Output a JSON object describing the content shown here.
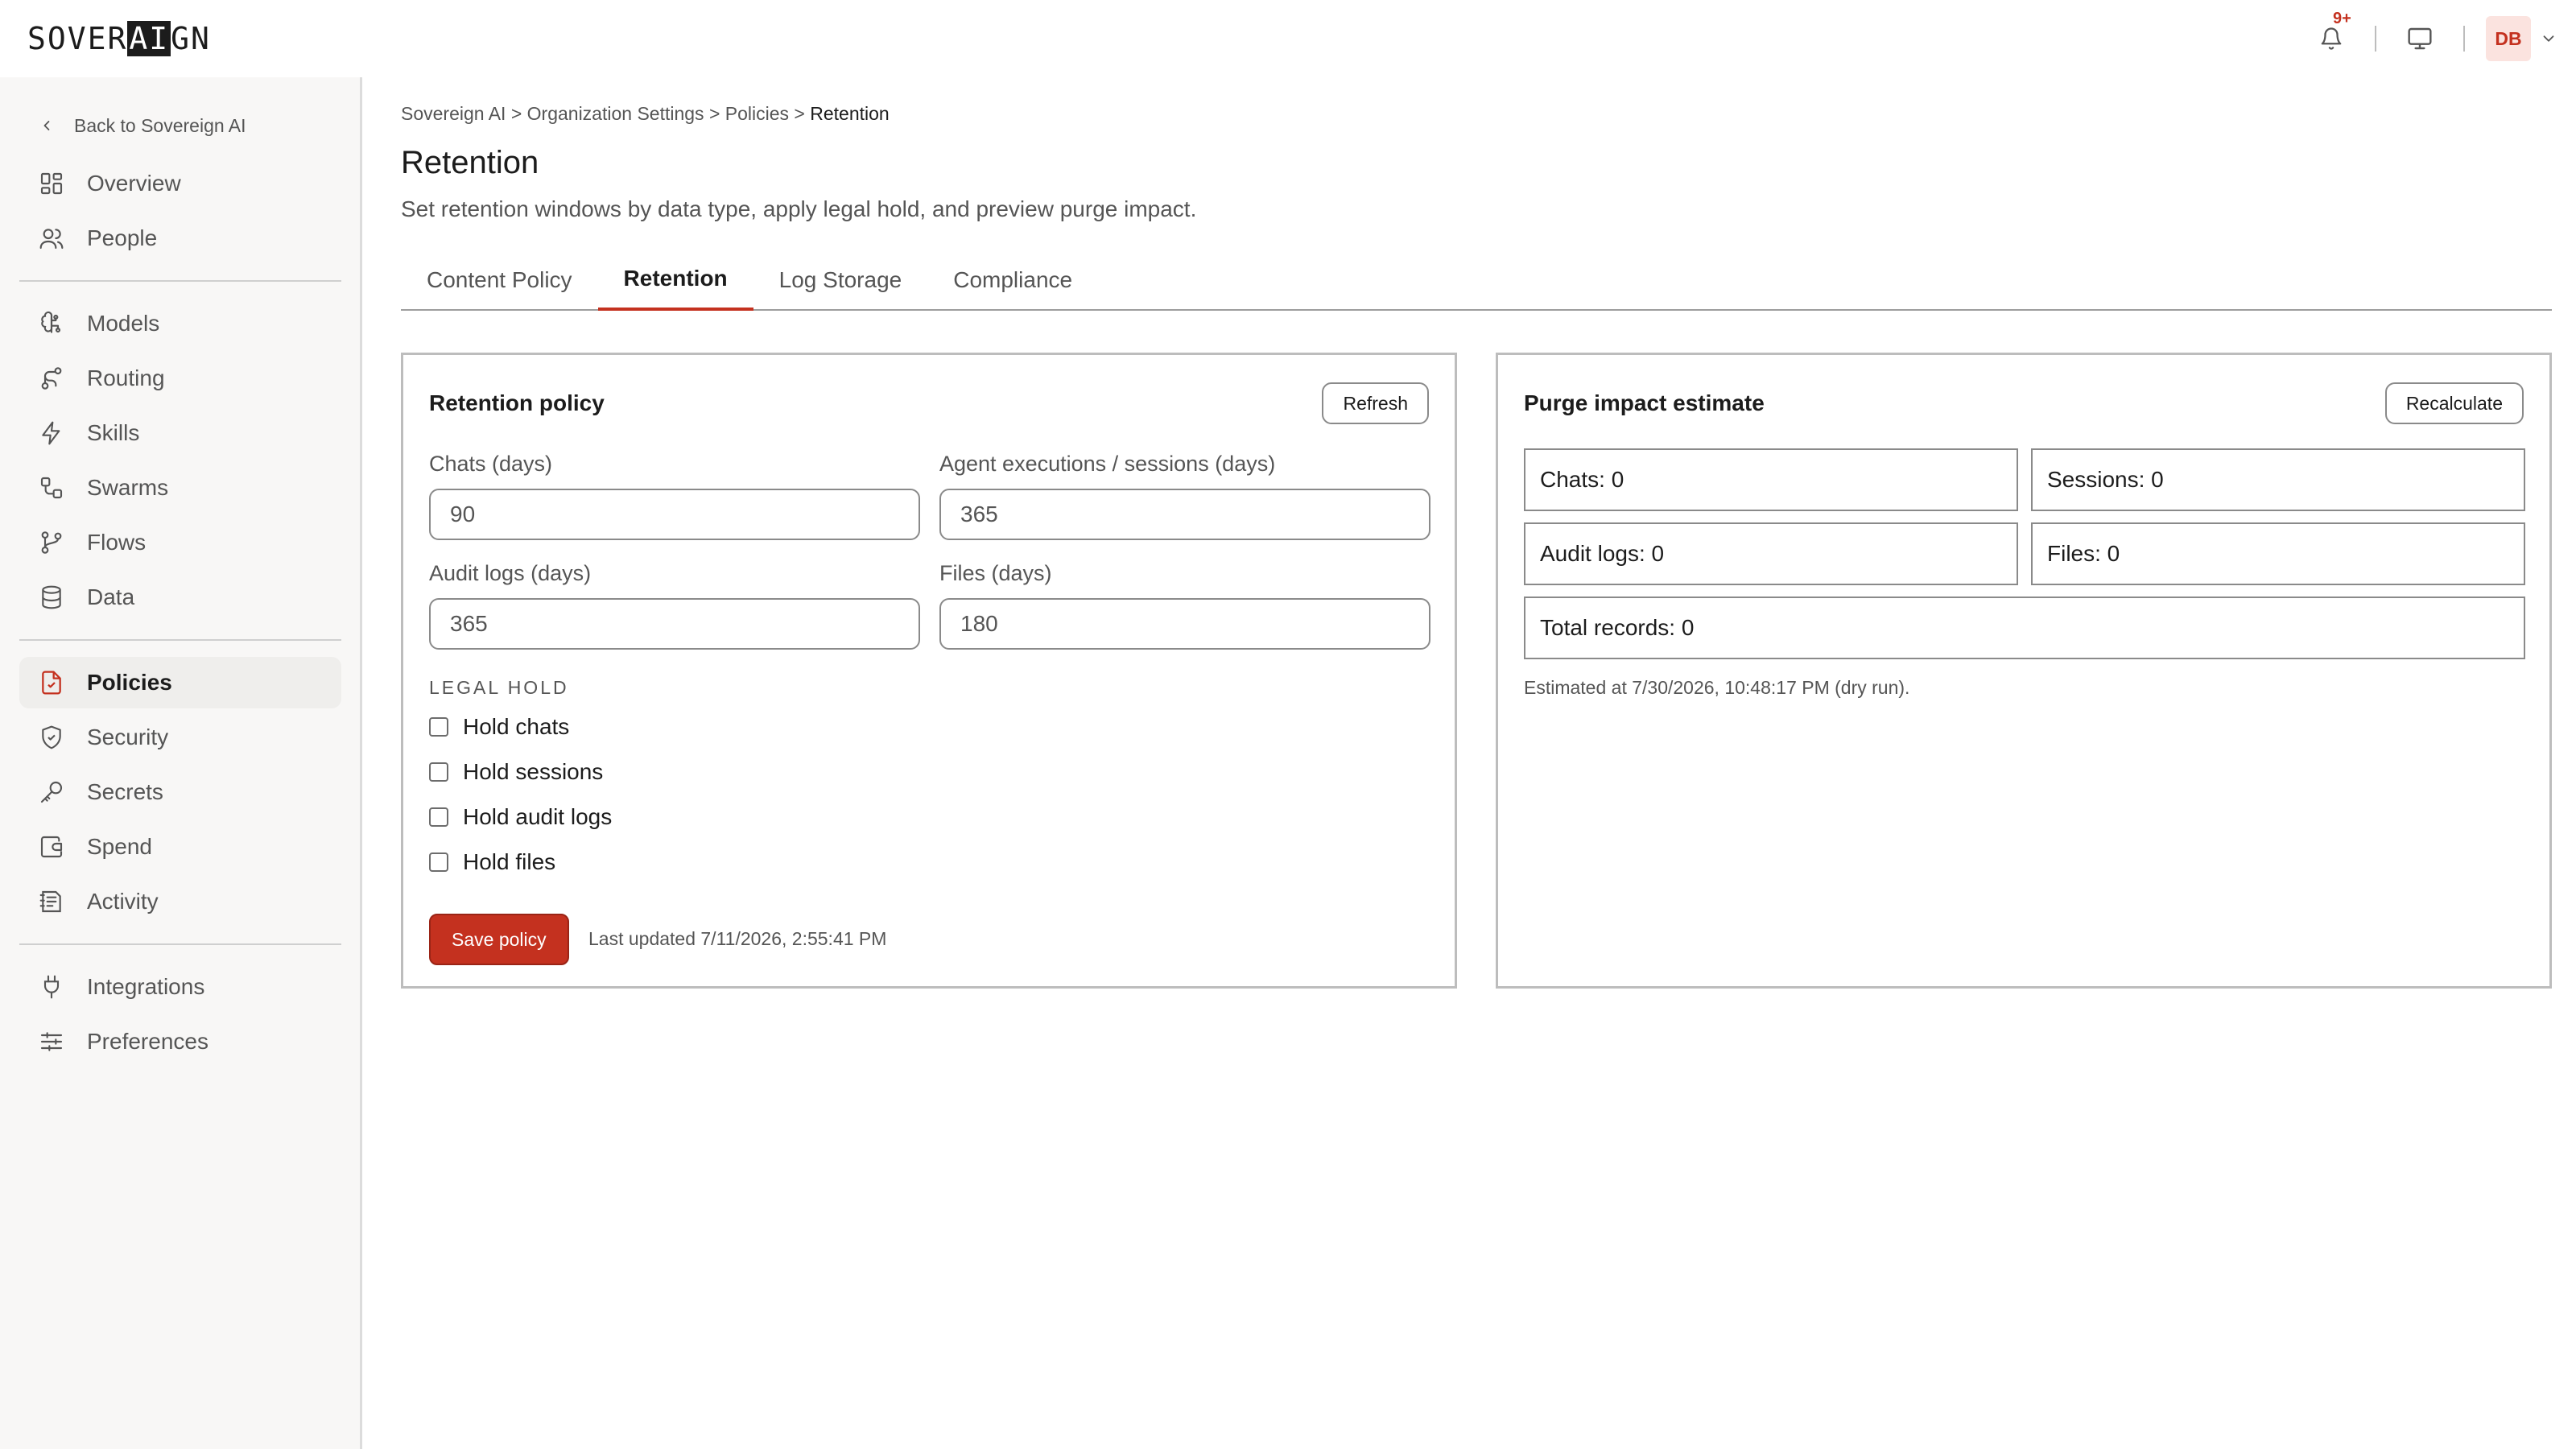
{
  "brand": {
    "logo_pre": "SOVER",
    "logo_hl": "AI",
    "logo_post": "GN"
  },
  "topbar": {
    "notification_badge": "9+",
    "avatar_initials": "DB"
  },
  "sidebar": {
    "back_label": "Back to Sovereign AI",
    "groups": [
      [
        {
          "label": "Overview",
          "icon": "overview-grid-icon"
        },
        {
          "label": "People",
          "icon": "people-icon"
        }
      ],
      [
        {
          "label": "Models",
          "icon": "brain-icon"
        },
        {
          "label": "Routing",
          "icon": "routing-icon"
        },
        {
          "label": "Skills",
          "icon": "bolt-icon"
        },
        {
          "label": "Swarms",
          "icon": "swarm-icon"
        },
        {
          "label": "Flows",
          "icon": "flow-branch-icon"
        },
        {
          "label": "Data",
          "icon": "database-icon"
        }
      ],
      [
        {
          "label": "Policies",
          "icon": "policy-document-icon",
          "active": true
        },
        {
          "label": "Security",
          "icon": "shield-icon"
        },
        {
          "label": "Secrets",
          "icon": "key-icon"
        },
        {
          "label": "Spend",
          "icon": "wallet-icon"
        },
        {
          "label": "Activity",
          "icon": "activity-log-icon"
        }
      ],
      [
        {
          "label": "Integrations",
          "icon": "plug-icon"
        },
        {
          "label": "Preferences",
          "icon": "sliders-icon"
        }
      ]
    ]
  },
  "breadcrumb": {
    "items": [
      "Sovereign AI",
      "Organization Settings",
      "Policies"
    ],
    "current": "Retention",
    "separator": ">"
  },
  "page": {
    "title": "Retention",
    "subtitle": "Set retention windows by data type, apply legal hold, and preview purge impact."
  },
  "tabs": [
    "Content Policy",
    "Retention",
    "Log Storage",
    "Compliance"
  ],
  "active_tab": "Retention",
  "retention_policy": {
    "title": "Retention policy",
    "refresh_label": "Refresh",
    "fields": {
      "chats": {
        "label": "Chats (days)",
        "value": "90"
      },
      "sessions": {
        "label": "Agent executions / sessions (days)",
        "value": "365"
      },
      "audit_logs": {
        "label": "Audit logs (days)",
        "value": "365"
      },
      "files": {
        "label": "Files (days)",
        "value": "180"
      }
    },
    "legal_hold_label": "LEGAL HOLD",
    "holds": [
      {
        "label": "Hold chats",
        "checked": false
      },
      {
        "label": "Hold sessions",
        "checked": false
      },
      {
        "label": "Hold audit logs",
        "checked": false
      },
      {
        "label": "Hold files",
        "checked": false
      }
    ],
    "save_label": "Save policy",
    "last_updated": "Last updated 7/11/2026, 2:55:41 PM"
  },
  "purge_impact": {
    "title": "Purge impact estimate",
    "recalculate_label": "Recalculate",
    "chats": "Chats: 0",
    "sessions": "Sessions: 0",
    "audit_logs": "Audit logs: 0",
    "files": "Files: 0",
    "total": "Total records: 0",
    "estimated": "Estimated at 7/30/2026, 10:48:17 PM (dry run)."
  },
  "colors": {
    "accent": "#c4311f",
    "sidebar_bg": "#f8f7f6",
    "active_nav_bg": "#efeeec",
    "border": "#bdbdbd"
  }
}
